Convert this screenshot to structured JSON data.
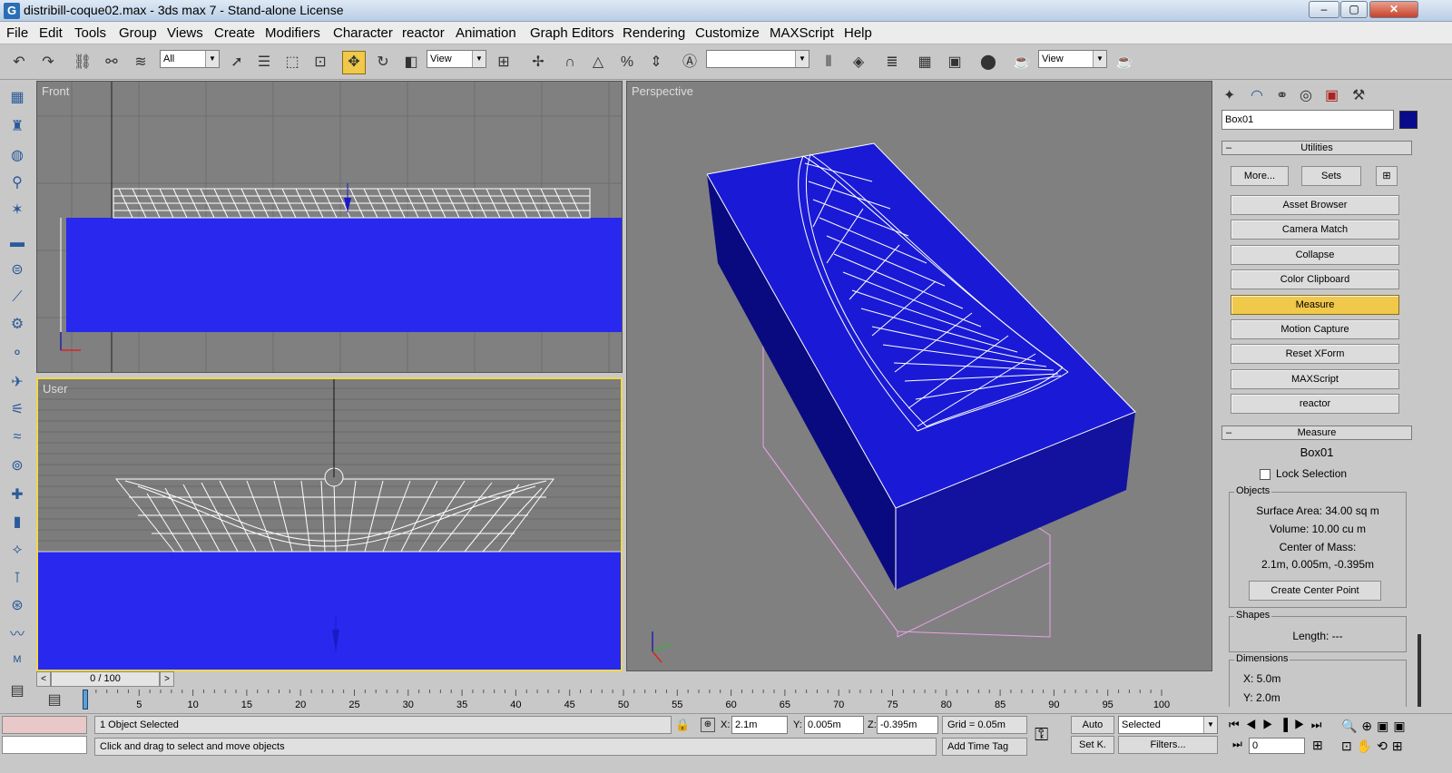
{
  "title": "distribill-coque02.max - 3ds max 7  - Stand-alone License",
  "window_buttons": {
    "min": "–",
    "max": "▢",
    "close": "✕"
  },
  "menu": [
    "File",
    "Edit",
    "Tools",
    "Group",
    "Views",
    "Create",
    "Modifiers",
    "Character",
    "reactor",
    "Animation",
    "Graph Editors",
    "Rendering",
    "Customize",
    "MAXScript",
    "Help"
  ],
  "toolbar": {
    "selection_filter": "All",
    "ref_coord": "View",
    "ref_coord2": "View",
    "named_sel": "",
    "snap_angle": "3"
  },
  "viewports": {
    "front": "Front",
    "user": "User",
    "perspective": "Perspective"
  },
  "panel": {
    "object_name": "Box01",
    "object_color": "#0a0a8c",
    "utilities_header": "Utilities",
    "more_btn": "More...",
    "sets_btn": "Sets",
    "utilities": [
      "Asset Browser",
      "Camera Match",
      "Collapse",
      "Color Clipboard",
      "Measure",
      "Motion Capture",
      "Reset XForm",
      "MAXScript",
      "reactor"
    ],
    "active_utility": "Measure",
    "measure_header": "Measure",
    "measure_object": "Box01",
    "lock_selection": "Lock Selection",
    "objects_group": "Objects",
    "surface_area": "Surface Area:  34.00 sq m",
    "volume": "Volume:  10.00 cu m",
    "center_of_mass_label": "Center of Mass:",
    "center_of_mass_value": "2.1m, 0.005m, -0.395m",
    "create_center_btn": "Create Center Point",
    "shapes_group": "Shapes",
    "length": "Length:  ---",
    "dimensions_group": "Dimensions",
    "dim_x": "X:   5.0m",
    "dim_y": "Y:   2.0m"
  },
  "timeline": {
    "slider": "0 / 100",
    "ticks": [
      "0",
      "5",
      "10",
      "15",
      "20",
      "25",
      "30",
      "35",
      "40",
      "45",
      "50",
      "55",
      "60",
      "65",
      "70",
      "75",
      "80",
      "85",
      "90",
      "95",
      "100"
    ]
  },
  "status": {
    "selected": "1 Object Selected",
    "prompt": "Click and drag to select and move objects",
    "x_label": "X:",
    "x": "2.1m",
    "y_label": "Y:",
    "y": "0.005m",
    "z_label": "Z:",
    "z": "-0.395m",
    "grid": "Grid = 0.05m",
    "add_time_tag": "Add Time Tag",
    "auto": "Auto",
    "setk": "Set K.",
    "selected_mode": "Selected",
    "filters": "Filters...",
    "frame": "0"
  }
}
